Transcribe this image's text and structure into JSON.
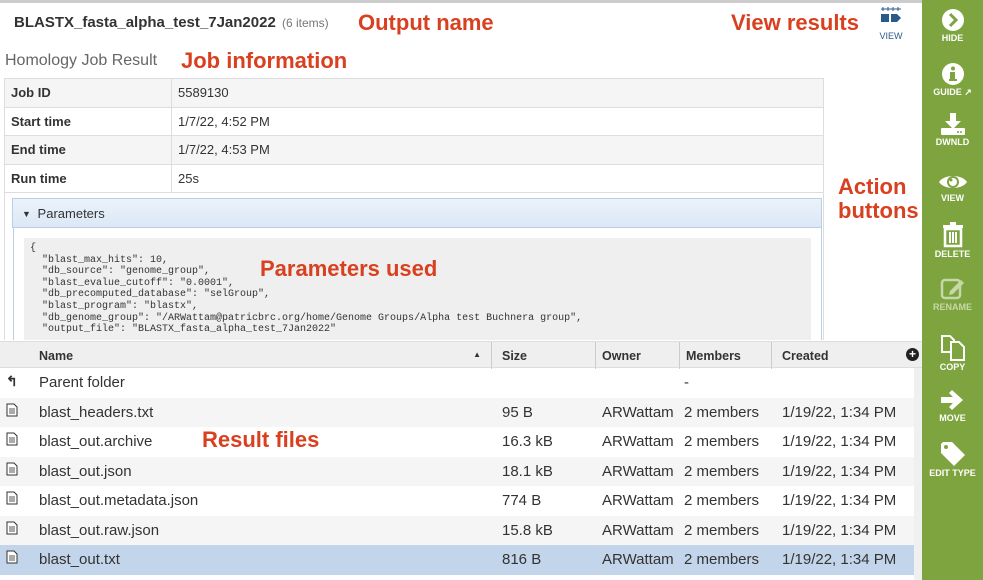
{
  "header": {
    "title": "BLASTX_fasta_alpha_test_7Jan2022",
    "item_count": "(6 items)",
    "view_label": "VIEW"
  },
  "annotations": {
    "output_name": "Output name",
    "view_results": "View results",
    "job_information": "Job information",
    "action_buttons_line1": "Action",
    "action_buttons_line2": "buttons",
    "parameters_used": "Parameters used",
    "result_files": "Result files",
    "color": "#d9401f"
  },
  "job": {
    "title": "Homology Job Result",
    "rows": [
      {
        "key": "Job ID",
        "value": "5589130"
      },
      {
        "key": "Start time",
        "value": "1/7/22, 4:52 PM"
      },
      {
        "key": "End time",
        "value": "1/7/22, 4:53 PM"
      },
      {
        "key": "Run time",
        "value": "25s"
      }
    ],
    "parameters_label": "Parameters",
    "parameters_text": "{\n  \"blast_max_hits\": 10,\n  \"db_source\": \"genome_group\",\n  \"blast_evalue_cutoff\": \"0.0001\",\n  \"db_precomputed_database\": \"selGroup\",\n  \"blast_program\": \"blastx\",\n  \"db_genome_group\": \"/ARWattam@patricbrc.org/home/Genome Groups/Alpha test Buchnera group\",\n  \"output_file\": \"BLASTX_fasta_alpha_test_7Jan2022\""
  },
  "grid": {
    "columns": [
      "Name",
      "Size",
      "Owner",
      "Members",
      "Created"
    ],
    "parent": {
      "name": "Parent folder",
      "members": "-"
    },
    "rows": [
      {
        "name": "blast_headers.txt",
        "size": "95 B",
        "owner": "ARWattam",
        "members": "2 members",
        "created": "1/19/22, 1:34 PM"
      },
      {
        "name": "blast_out.archive",
        "size": "16.3 kB",
        "owner": "ARWattam",
        "members": "2 members",
        "created": "1/19/22, 1:34 PM"
      },
      {
        "name": "blast_out.json",
        "size": "18.1 kB",
        "owner": "ARWattam",
        "members": "2 members",
        "created": "1/19/22, 1:34 PM"
      },
      {
        "name": "blast_out.metadata.json",
        "size": "774 B",
        "owner": "ARWattam",
        "members": "2 members",
        "created": "1/19/22, 1:34 PM"
      },
      {
        "name": "blast_out.raw.json",
        "size": "15.8 kB",
        "owner": "ARWattam",
        "members": "2 members",
        "created": "1/19/22, 1:34 PM"
      },
      {
        "name": "blast_out.txt",
        "size": "816 B",
        "owner": "ARWattam",
        "members": "2 members",
        "created": "1/19/22, 1:34 PM",
        "selected": true
      }
    ]
  },
  "sidebar": {
    "color": "#7ea43f",
    "items": [
      {
        "label": "HIDE",
        "icon": "chevron-right-circle-icon"
      },
      {
        "label": "GUIDE",
        "icon": "info-icon"
      },
      {
        "label": "DWNLD",
        "icon": "download-icon"
      },
      {
        "label": "VIEW",
        "icon": "eye-icon"
      },
      {
        "label": "DELETE",
        "icon": "trash-icon"
      },
      {
        "label": "RENAME",
        "icon": "edit-icon",
        "disabled": true
      },
      {
        "label": "COPY",
        "icon": "copy-icon"
      },
      {
        "label": "MOVE",
        "icon": "arrow-right-icon"
      },
      {
        "label": "EDIT TYPE",
        "icon": "tag-icon"
      }
    ]
  }
}
